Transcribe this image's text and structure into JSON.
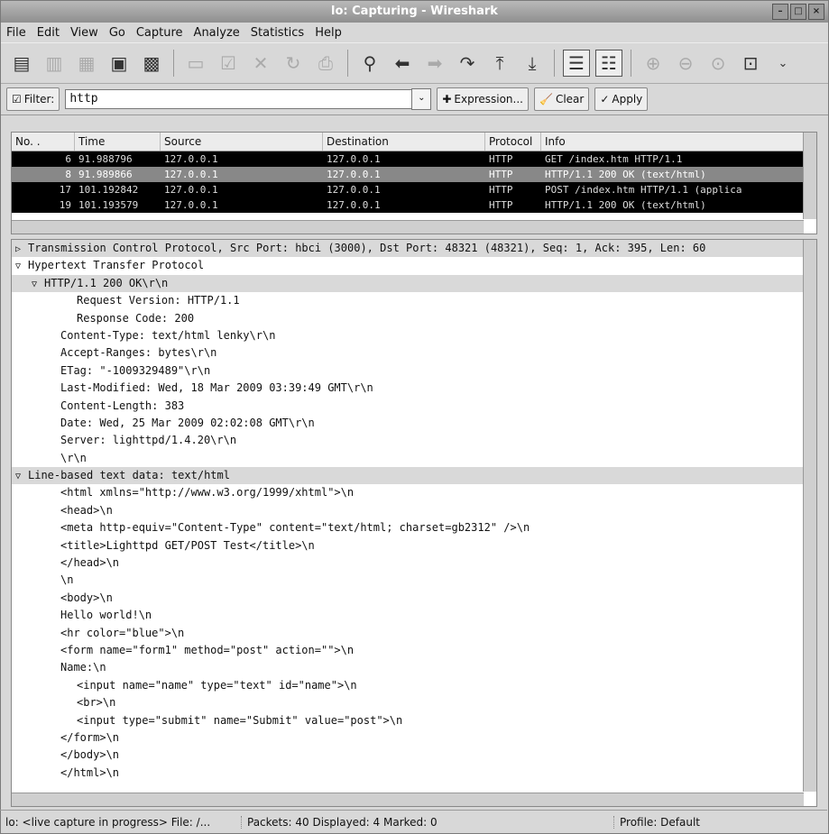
{
  "window": {
    "title": "lo: Capturing - Wireshark"
  },
  "menu": [
    "File",
    "Edit",
    "View",
    "Go",
    "Capture",
    "Analyze",
    "Statistics",
    "Help"
  ],
  "filter": {
    "label": "Filter:",
    "value": "http",
    "expression_label": "Expression...",
    "clear_label": "Clear",
    "apply_label": "Apply"
  },
  "packet_list": {
    "headers": [
      "No. .",
      "Time",
      "Source",
      "Destination",
      "Protocol",
      "Info"
    ],
    "rows": [
      {
        "no": "6",
        "time": "91.988796",
        "src": "127.0.0.1",
        "dst": "127.0.0.1",
        "proto": "HTTP",
        "info": "GET /index.htm HTTP/1.1"
      },
      {
        "no": "8",
        "time": "91.989866",
        "src": "127.0.0.1",
        "dst": "127.0.0.1",
        "proto": "HTTP",
        "info": "HTTP/1.1 200 OK  (text/html)"
      },
      {
        "no": "17",
        "time": "101.192842",
        "src": "127.0.0.1",
        "dst": "127.0.0.1",
        "proto": "HTTP",
        "info": "POST /index.htm HTTP/1.1  (applica"
      },
      {
        "no": "19",
        "time": "101.193579",
        "src": "127.0.0.1",
        "dst": "127.0.0.1",
        "proto": "HTTP",
        "info": "HTTP/1.1 200 OK  (text/html)"
      }
    ]
  },
  "details": [
    {
      "indent": 0,
      "toggle": "▷",
      "hl": true,
      "text": "Transmission Control Protocol, Src Port: hbci (3000), Dst Port: 48321 (48321), Seq: 1, Ack: 395, Len: 60"
    },
    {
      "indent": 0,
      "toggle": "▽",
      "hl": false,
      "text": "Hypertext Transfer Protocol"
    },
    {
      "indent": 1,
      "toggle": "▽",
      "hl": true,
      "text": "HTTP/1.1 200 OK\\r\\n"
    },
    {
      "indent": 3,
      "toggle": "",
      "hl": false,
      "text": "Request Version: HTTP/1.1"
    },
    {
      "indent": 3,
      "toggle": "",
      "hl": false,
      "text": "Response Code: 200"
    },
    {
      "indent": 2,
      "toggle": "",
      "hl": false,
      "text": "Content-Type: text/html lenky\\r\\n"
    },
    {
      "indent": 2,
      "toggle": "",
      "hl": false,
      "text": "Accept-Ranges: bytes\\r\\n"
    },
    {
      "indent": 2,
      "toggle": "",
      "hl": false,
      "text": "ETag: \"-1009329489\"\\r\\n"
    },
    {
      "indent": 2,
      "toggle": "",
      "hl": false,
      "text": "Last-Modified: Wed, 18 Mar 2009 03:39:49 GMT\\r\\n"
    },
    {
      "indent": 2,
      "toggle": "",
      "hl": false,
      "text": "Content-Length: 383"
    },
    {
      "indent": 2,
      "toggle": "",
      "hl": false,
      "text": "Date: Wed, 25 Mar 2009 02:02:08 GMT\\r\\n"
    },
    {
      "indent": 2,
      "toggle": "",
      "hl": false,
      "text": "Server: lighttpd/1.4.20\\r\\n"
    },
    {
      "indent": 2,
      "toggle": "",
      "hl": false,
      "text": "\\r\\n"
    },
    {
      "indent": 0,
      "toggle": "▽",
      "hl": true,
      "text": "Line-based text data: text/html"
    },
    {
      "indent": 2,
      "toggle": "",
      "hl": false,
      "text": "<html xmlns=\"http://www.w3.org/1999/xhtml\">\\n"
    },
    {
      "indent": 2,
      "toggle": "",
      "hl": false,
      "text": "<head>\\n"
    },
    {
      "indent": 2,
      "toggle": "",
      "hl": false,
      "text": "<meta http-equiv=\"Content-Type\" content=\"text/html; charset=gb2312\" />\\n"
    },
    {
      "indent": 2,
      "toggle": "",
      "hl": false,
      "text": "<title>Lighttpd GET/POST Test</title>\\n"
    },
    {
      "indent": 2,
      "toggle": "",
      "hl": false,
      "text": "</head>\\n"
    },
    {
      "indent": 2,
      "toggle": "",
      "hl": false,
      "text": "\\n"
    },
    {
      "indent": 2,
      "toggle": "",
      "hl": false,
      "text": "<body>\\n"
    },
    {
      "indent": 2,
      "toggle": "",
      "hl": false,
      "text": "Hello world!\\n"
    },
    {
      "indent": 2,
      "toggle": "",
      "hl": false,
      "text": "<hr color=\"blue\">\\n"
    },
    {
      "indent": 2,
      "toggle": "",
      "hl": false,
      "text": "<form name=\"form1\" method=\"post\" action=\"\">\\n"
    },
    {
      "indent": 2,
      "toggle": "",
      "hl": false,
      "text": "Name:\\n"
    },
    {
      "indent": 3,
      "toggle": "",
      "hl": false,
      "text": "<input name=\"name\" type=\"text\" id=\"name\">\\n"
    },
    {
      "indent": 3,
      "toggle": "",
      "hl": false,
      "text": "<br>\\n"
    },
    {
      "indent": 3,
      "toggle": "",
      "hl": false,
      "text": "<input type=\"submit\" name=\"Submit\" value=\"post\">\\n"
    },
    {
      "indent": 2,
      "toggle": "",
      "hl": false,
      "text": "</form>\\n"
    },
    {
      "indent": 2,
      "toggle": "",
      "hl": false,
      "text": "</body>\\n"
    },
    {
      "indent": 2,
      "toggle": "",
      "hl": false,
      "text": "</html>\\n"
    }
  ],
  "status": {
    "capture": "lo: <live capture in progress> File: /...",
    "packets": "Packets: 40 Displayed: 4 Marked: 0",
    "profile": "Profile: Default"
  }
}
